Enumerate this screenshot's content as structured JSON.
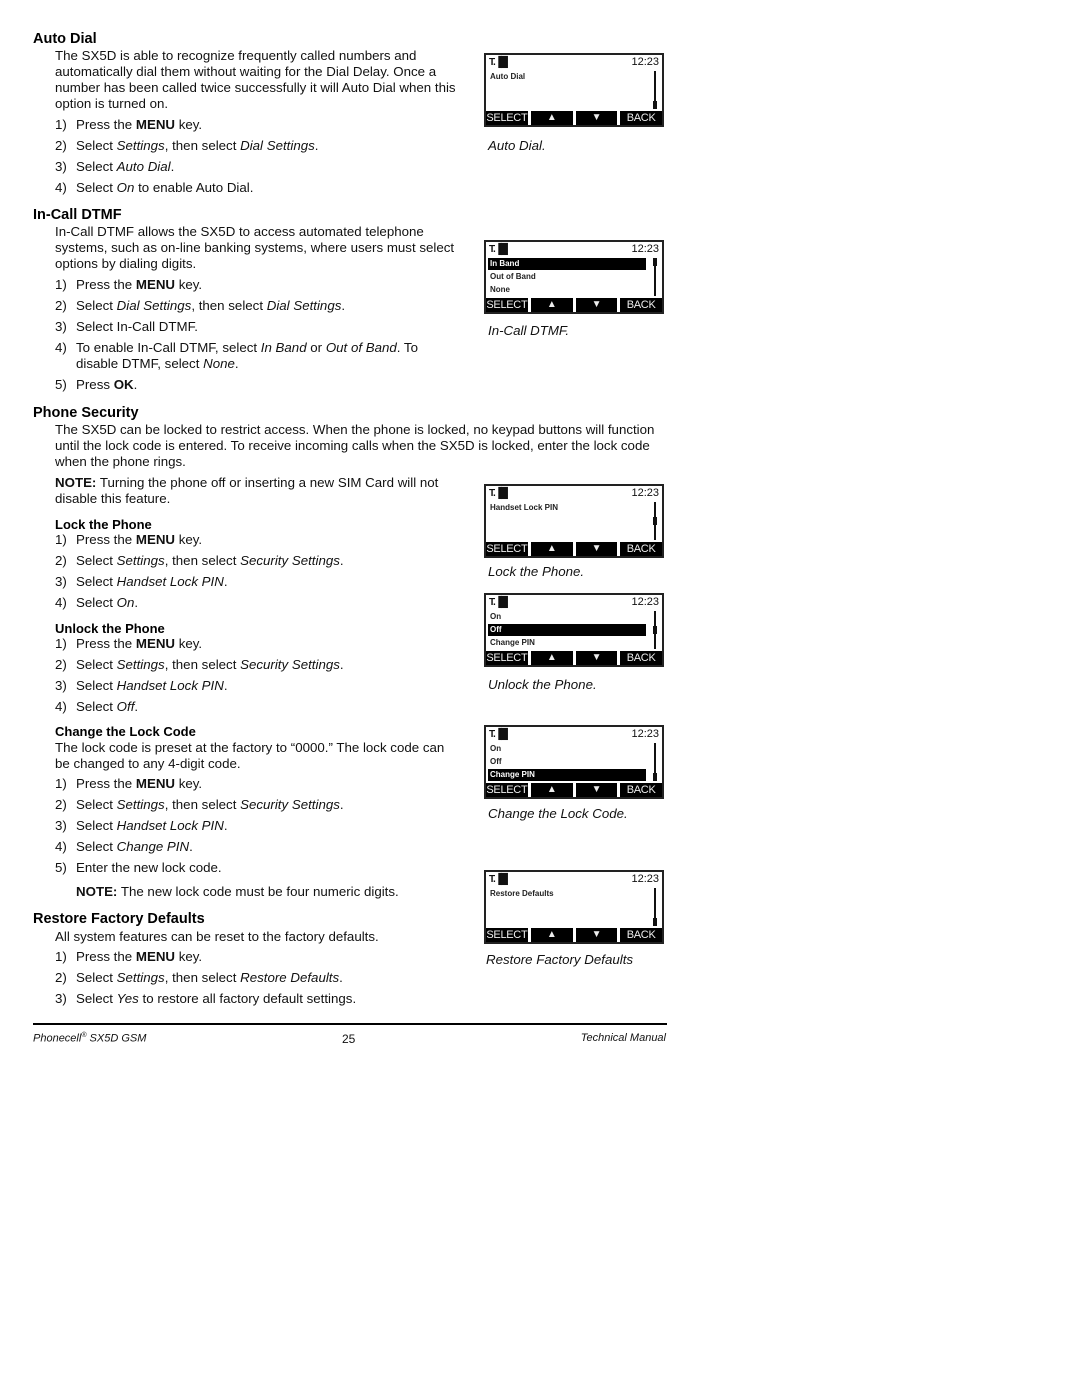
{
  "sections": {
    "auto_dial": {
      "title": "Auto Dial",
      "intro": "The SX5D is able to recognize frequently called numbers and automatically dial them without waiting for the Dial Delay. Once a number has been called twice successfully it will Auto Dial when this option is turned on.",
      "steps": [
        {
          "num": "1)",
          "parts": [
            {
              "t": "Press the "
            },
            {
              "t": "MENU",
              "b": true
            },
            {
              "t": " key."
            }
          ]
        },
        {
          "num": "2)",
          "parts": [
            {
              "t": "Select "
            },
            {
              "t": "Settings",
              "i": true
            },
            {
              "t": ", then select "
            },
            {
              "t": "Dial Settings",
              "i": true
            },
            {
              "t": "."
            }
          ]
        },
        {
          "num": "3)",
          "parts": [
            {
              "t": "Select "
            },
            {
              "t": "Auto Dial",
              "i": true
            },
            {
              "t": "."
            }
          ]
        },
        {
          "num": "4)",
          "parts": [
            {
              "t": "Select "
            },
            {
              "t": "On",
              "i": true
            },
            {
              "t": " to enable Auto Dial."
            }
          ]
        }
      ],
      "caption": "Auto Dial."
    },
    "in_call_dtmf": {
      "title": "In-Call DTMF",
      "intro": "In-Call DTMF allows the SX5D to access automated telephone systems, such as on-line banking systems, where users must select options by dialing digits.",
      "steps": [
        {
          "num": "1)",
          "parts": [
            {
              "t": "Press the "
            },
            {
              "t": "MENU",
              "b": true
            },
            {
              "t": " key."
            }
          ]
        },
        {
          "num": "2)",
          "parts": [
            {
              "t": "Select "
            },
            {
              "t": "Dial Settings",
              "i": true
            },
            {
              "t": ", then select "
            },
            {
              "t": "Dial Settings",
              "i": true
            },
            {
              "t": "."
            }
          ]
        },
        {
          "num": "3)",
          "parts": [
            {
              "t": "Select In-Call DTMF."
            }
          ]
        },
        {
          "num": "4)",
          "parts": [
            {
              "t": "To enable In-Call DTMF, select "
            },
            {
              "t": "In Band",
              "i": true
            },
            {
              "t": " or "
            },
            {
              "t": "Out of Band",
              "i": true
            },
            {
              "t": ". To disable DTMF, select "
            },
            {
              "t": "None",
              "i": true
            },
            {
              "t": "."
            }
          ]
        },
        {
          "num": "5)",
          "parts": [
            {
              "t": "Press "
            },
            {
              "t": "OK",
              "b": true
            },
            {
              "t": "."
            }
          ]
        }
      ],
      "caption": "In-Call DTMF."
    },
    "phone_security": {
      "title": "Phone Security",
      "intro": "The SX5D can be locked to restrict access. When the phone is locked, no keypad buttons will function until the lock code is entered. To receive incoming calls when the SX5D is locked, enter the lock code when the phone rings.",
      "note_label": "NOTE:",
      "note_text": " Turning the phone off or inserting a new SIM Card will not disable this feature.",
      "lock": {
        "title": "Lock the Phone",
        "steps": [
          {
            "num": "1)",
            "parts": [
              {
                "t": "Press the "
              },
              {
                "t": "MENU",
                "b": true
              },
              {
                "t": " key."
              }
            ]
          },
          {
            "num": "2)",
            "parts": [
              {
                "t": "Select "
              },
              {
                "t": "Settings",
                "i": true
              },
              {
                "t": ", then select "
              },
              {
                "t": "Security Settings",
                "i": true
              },
              {
                "t": "."
              }
            ]
          },
          {
            "num": "3)",
            "parts": [
              {
                "t": "Select "
              },
              {
                "t": "Handset Lock PIN",
                "i": true
              },
              {
                "t": "."
              }
            ]
          },
          {
            "num": "4)",
            "parts": [
              {
                "t": "Select "
              },
              {
                "t": "On",
                "i": true
              },
              {
                "t": "."
              }
            ]
          }
        ],
        "caption": "Lock the Phone."
      },
      "unlock": {
        "title": "Unlock the Phone",
        "steps": [
          {
            "num": "1)",
            "parts": [
              {
                "t": "Press the "
              },
              {
                "t": "MENU",
                "b": true
              },
              {
                "t": " key."
              }
            ]
          },
          {
            "num": "2)",
            "parts": [
              {
                "t": "Select "
              },
              {
                "t": "Settings",
                "i": true
              },
              {
                "t": ", then select "
              },
              {
                "t": "Security Settings",
                "i": true
              },
              {
                "t": "."
              }
            ]
          },
          {
            "num": "3)",
            "parts": [
              {
                "t": "Select "
              },
              {
                "t": "Handset Lock PIN",
                "i": true
              },
              {
                "t": "."
              }
            ]
          },
          {
            "num": "4)",
            "parts": [
              {
                "t": "Select "
              },
              {
                "t": "Off",
                "i": true
              },
              {
                "t": "."
              }
            ]
          }
        ],
        "caption": "Unlock the Phone."
      },
      "change": {
        "title": "Change the Lock Code",
        "intro": "The lock code is preset at the factory to “0000.” The lock code can be changed to any 4-digit code.",
        "steps": [
          {
            "num": "1)",
            "parts": [
              {
                "t": "Press the "
              },
              {
                "t": "MENU",
                "b": true
              },
              {
                "t": " key."
              }
            ]
          },
          {
            "num": "2)",
            "parts": [
              {
                "t": "Select "
              },
              {
                "t": "Settings",
                "i": true
              },
              {
                "t": ", then select "
              },
              {
                "t": "Security Settings",
                "i": true
              },
              {
                "t": "."
              }
            ]
          },
          {
            "num": "3)",
            "parts": [
              {
                "t": "Select "
              },
              {
                "t": "Handset Lock PIN",
                "i": true
              },
              {
                "t": "."
              }
            ]
          },
          {
            "num": "4)",
            "parts": [
              {
                "t": "Select "
              },
              {
                "t": "Change PIN",
                "i": true
              },
              {
                "t": "."
              }
            ]
          },
          {
            "num": "5)",
            "parts": [
              {
                "t": "Enter the new lock code."
              }
            ]
          }
        ],
        "note_label": "NOTE:",
        "note_text": " The new lock code must be four numeric digits.",
        "caption": "Change the Lock Code."
      }
    },
    "restore": {
      "title": "Restore Factory Defaults",
      "intro": "All system features can be reset to the factory defaults.",
      "steps": [
        {
          "num": "1)",
          "parts": [
            {
              "t": "Press the "
            },
            {
              "t": "MENU",
              "b": true
            },
            {
              "t": " key."
            }
          ]
        },
        {
          "num": "2)",
          "parts": [
            {
              "t": "Select "
            },
            {
              "t": "Settings",
              "i": true
            },
            {
              "t": ", then select "
            },
            {
              "t": "Restore Defaults",
              "i": true
            },
            {
              "t": "."
            }
          ]
        },
        {
          "num": "3)",
          "parts": [
            {
              "t": "Select "
            },
            {
              "t": "Yes",
              "i": true
            },
            {
              "t": " to restore all factory default settings."
            }
          ]
        }
      ],
      "caption": "Restore Factory Defaults"
    }
  },
  "screens": {
    "common": {
      "signal": "T.▐█",
      "clock": "12:23",
      "softkeys": [
        "SELECT",
        "▲",
        "▼",
        "BACK"
      ]
    },
    "auto_dial": {
      "rows": [
        "Auto Dial"
      ],
      "selected": -1,
      "scroll_pos": 1.0
    },
    "dtmf": {
      "rows": [
        "In Band",
        "Out of Band",
        "None"
      ],
      "selected": 0,
      "scroll_pos": 0.0
    },
    "lock": {
      "rows": [
        "Handset Lock PIN"
      ],
      "selected": -1,
      "scroll_pos": 0.5
    },
    "unlock": {
      "rows": [
        "On",
        "Off",
        "Change PIN"
      ],
      "selected": 1,
      "scroll_pos": 0.5
    },
    "change": {
      "rows": [
        "On",
        "Off",
        "Change PIN"
      ],
      "selected": 2,
      "scroll_pos": 1.0
    },
    "restore": {
      "rows": [
        "Restore Defaults"
      ],
      "selected": -1,
      "scroll_pos": 1.0
    }
  },
  "footer": {
    "product": "Phonecell",
    "reg": "®",
    "model": " SX5D GSM",
    "page": "25",
    "manual": "Technical Manual"
  }
}
